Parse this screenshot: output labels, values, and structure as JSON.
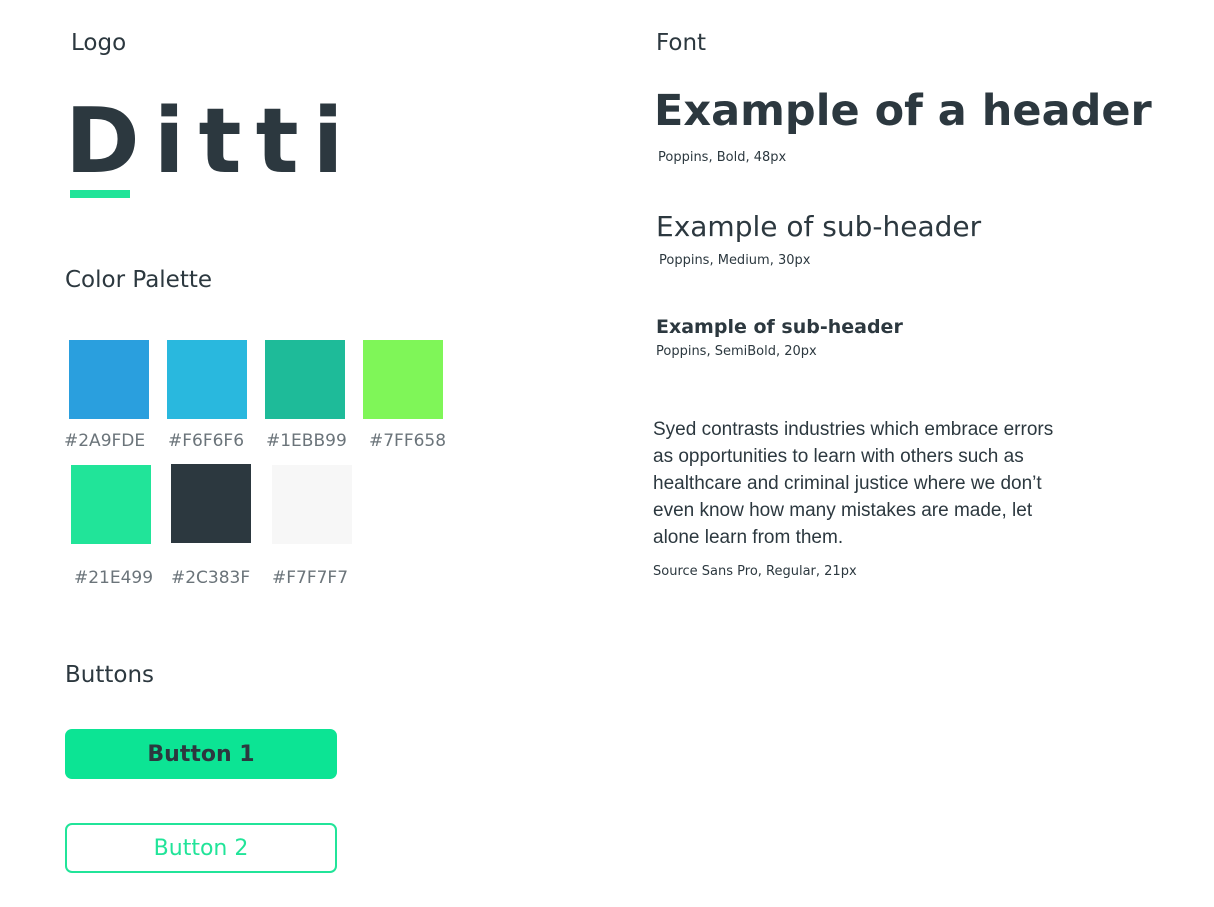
{
  "sections": {
    "logo": "Logo",
    "font": "Font",
    "palette": "Color Palette",
    "buttons": "Buttons"
  },
  "logo": {
    "word": "Ditti",
    "underline_color": "#21E499"
  },
  "palette": {
    "swatches": [
      {
        "fill": "#2A9FDE",
        "label": "#2A9FDE"
      },
      {
        "fill": "#29B8DE",
        "label": "#F6F6F6"
      },
      {
        "fill": "#1EBB99",
        "label": "#1EBB99"
      },
      {
        "fill": "#7FF658",
        "label": "#7FF658"
      },
      {
        "fill": "#21E499",
        "label": "#21E499"
      },
      {
        "fill": "#2C383F",
        "label": "#2C383F"
      },
      {
        "fill": "#F7F7F7",
        "label": "#F7F7F7"
      }
    ]
  },
  "buttons": {
    "primary_label": "Button 1",
    "secondary_label": "Button 2"
  },
  "typography": {
    "header": {
      "sample": "Example of a header",
      "spec": "Poppins, Bold, 48px"
    },
    "subheader": {
      "sample": "Example of sub-header",
      "spec": "Poppins, Medium, 30px"
    },
    "small_subheader": {
      "sample": "Example of sub-header",
      "spec": "Poppins, SemiBold, 20px"
    },
    "body": {
      "sample": "Syed contrasts industries which embrace errors as opportunities to learn with others such as healthcare and criminal justice where we don’t even know how many mistakes are made, let alone learn from them.",
      "spec": "Source Sans Pro, Regular, 21px"
    }
  }
}
